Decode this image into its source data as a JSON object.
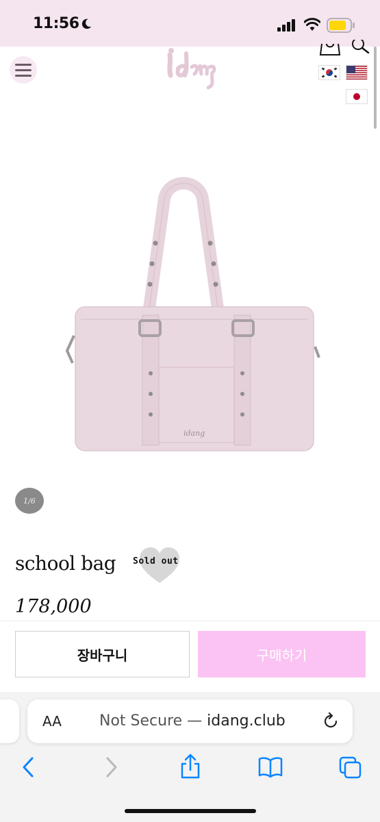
{
  "status_bar": {
    "time": "11:56",
    "icons": [
      "moon-icon",
      "signal-icon",
      "wifi-icon",
      "battery-icon"
    ],
    "battery_color": "#ffd60a"
  },
  "header": {
    "logo_text": "idang",
    "icons": [
      "menu-icon",
      "cart-icon",
      "search-icon"
    ],
    "flags": [
      "korea-flag",
      "usa-flag",
      "japan-flag"
    ]
  },
  "gallery": {
    "pager": "1/6"
  },
  "product": {
    "name": "school bag",
    "badge": "Sold out",
    "price": "178,000",
    "bag_color": "#ead8e0"
  },
  "actions": {
    "cart_label": "장바구니",
    "buy_label": "구매하기",
    "buy_color": "#fbc3f3"
  },
  "browser": {
    "aa_label": "AA",
    "url_prefix": "Not Secure — ",
    "url_domain": "idang.club",
    "toolbar": [
      "back-icon",
      "forward-icon",
      "share-icon",
      "bookmarks-icon",
      "tabs-icon"
    ]
  }
}
